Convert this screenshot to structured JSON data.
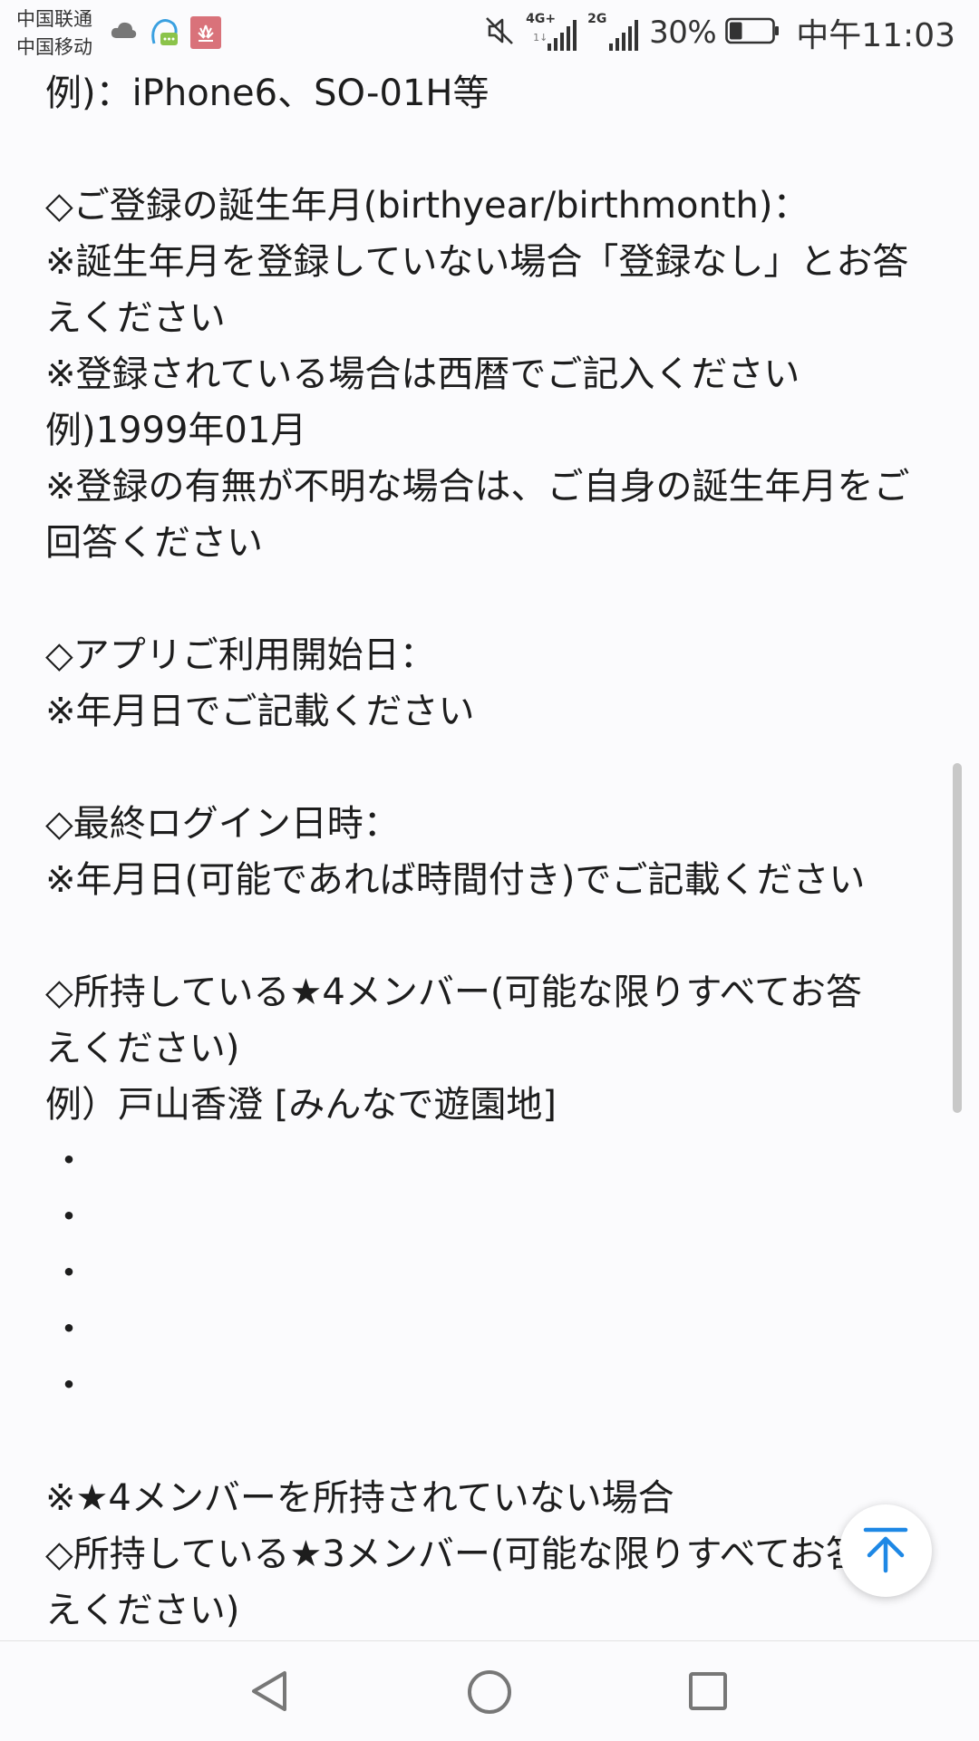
{
  "status_bar": {
    "carrier_1": "中国联通",
    "carrier_2": "中国移动",
    "network_1": "4G+",
    "network_1_sub": "1↓",
    "network_2": "2G",
    "battery_percent": "30%",
    "battery_level": 0.3,
    "time": "中午11:03",
    "icons": [
      "cloud-icon",
      "message-icon",
      "huawei-app-icon",
      "mute-icon",
      "signal-icon",
      "battery-icon"
    ]
  },
  "content": {
    "lines": [
      "例)：iPhone6、SO-01H等",
      "",
      "◇ご登録の誕生年月(birthyear/birthmonth)：",
      "※誕生年月を登録していない場合「登録なし」とお答",
      "えください",
      "※登録されている場合は西暦でご記入ください",
      "例)1999年01月",
      "※登録の有無が不明な場合は、ご自身の誕生年月をご",
      "回答ください",
      "",
      "◇アプリご利用開始日：",
      "※年月日でご記載ください",
      "",
      "◇最終ログイン日時：",
      "※年月日(可能であれば時間付き)でご記載ください",
      "",
      "◇所持している★4メンバー(可能な限りすべてお答",
      "えください)",
      "例）戸山香澄 [みんなで遊園地]",
      "・",
      "・",
      "・",
      "・",
      "・",
      "",
      "※★4メンバーを所持されていない場合",
      "◇所持している★3メンバー(可能な限りすべてお答",
      "えください)"
    ]
  },
  "colors": {
    "background": "#fbfbfd",
    "text": "#1d1d1d",
    "accent": "#1e88e5",
    "scrollbar": "#c8c8c8"
  },
  "nav_bar": {
    "icons": [
      "back-icon",
      "home-icon",
      "recent-apps-icon"
    ]
  }
}
